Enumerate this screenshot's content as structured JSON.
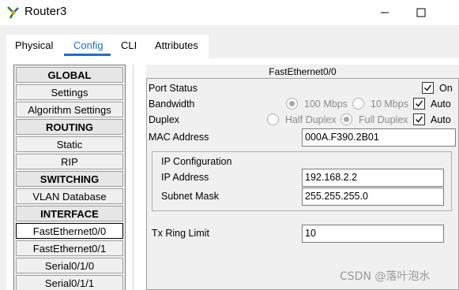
{
  "window": {
    "title": "Router3"
  },
  "tabs": [
    {
      "label": "Physical"
    },
    {
      "label": "Config"
    },
    {
      "label": "CLI"
    },
    {
      "label": "Attributes"
    }
  ],
  "nav": {
    "items": [
      {
        "label": "GLOBAL"
      },
      {
        "label": "Settings"
      },
      {
        "label": "Algorithm Settings"
      },
      {
        "label": "ROUTING"
      },
      {
        "label": "Static"
      },
      {
        "label": "RIP"
      },
      {
        "label": "SWITCHING"
      },
      {
        "label": "VLAN Database"
      },
      {
        "label": "INTERFACE"
      },
      {
        "label": "FastEthernet0/0"
      },
      {
        "label": "FastEthernet0/1"
      },
      {
        "label": "Serial0/1/0"
      },
      {
        "label": "Serial0/1/1"
      }
    ]
  },
  "panel": {
    "title": "FastEthernet0/0",
    "port_status": {
      "label": "Port Status",
      "on_label": "On"
    },
    "bandwidth": {
      "label": "Bandwidth",
      "opt1": "100 Mbps",
      "opt2": "10 Mbps",
      "auto_label": "Auto"
    },
    "duplex": {
      "label": "Duplex",
      "opt1": "Half Duplex",
      "opt2": "Full Duplex",
      "auto_label": "Auto"
    },
    "mac": {
      "label": "MAC Address",
      "value": "000A.F390.2B01"
    },
    "ip_config": {
      "title": "IP Configuration",
      "ip_label": "IP Address",
      "ip_value": "192.168.2.2",
      "mask_label": "Subnet Mask",
      "mask_value": "255.255.255.0"
    },
    "tx_ring": {
      "label": "Tx Ring Limit",
      "value": "10"
    }
  },
  "watermark": "CSDN @落叶泡水",
  "colors": {
    "accent": "#1a6fc8"
  }
}
